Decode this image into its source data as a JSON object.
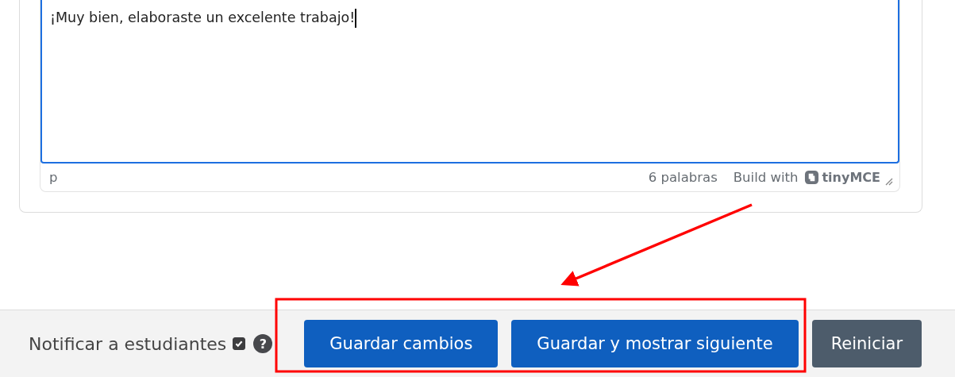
{
  "editor": {
    "text": "¡Muy bien, elaboraste un excelente trabajo!",
    "status_bar": {
      "path": "p",
      "word_count": "6 palabras",
      "branding": "Build with",
      "brand": "tinyMCE"
    }
  },
  "footer": {
    "notify": {
      "label": "Notificar a estudiantes",
      "checked": true,
      "help": "?"
    },
    "buttons": [
      {
        "label": "Guardar cambios",
        "kind": "primary"
      },
      {
        "label": "Guardar y mostrar siguiente",
        "kind": "primary"
      },
      {
        "label": "Reiniciar",
        "kind": "secondary"
      }
    ]
  }
}
